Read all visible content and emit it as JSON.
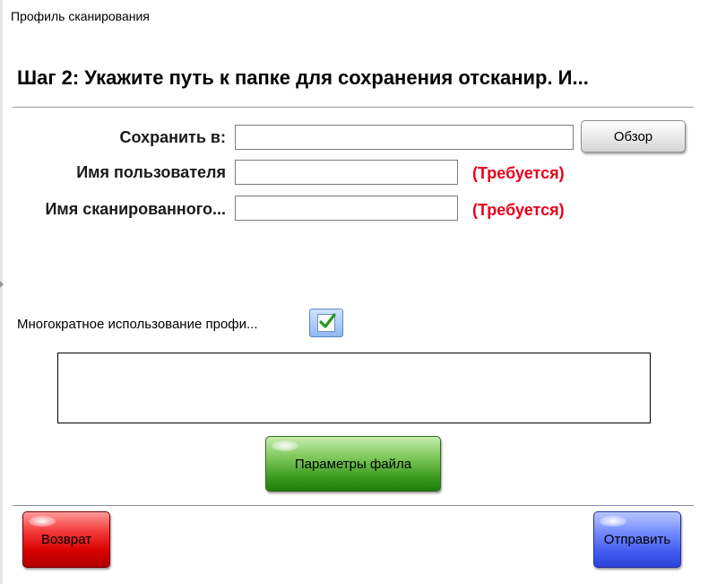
{
  "window": {
    "title": "Профиль сканирования"
  },
  "step": {
    "heading": "Шаг 2: Укажите путь к папке для сохранения отсканир. И..."
  },
  "form": {
    "save_to": {
      "label": "Сохранить в:",
      "value": "",
      "browse_label": "Обзор"
    },
    "username": {
      "label": "Имя пользователя",
      "value": "",
      "required_text": "(Требуется)"
    },
    "scanned_name": {
      "label": "Имя сканированного...",
      "value": "",
      "required_text": "(Требуется)"
    }
  },
  "reuse_profile": {
    "label": "Многократное использование профи...",
    "checked": true
  },
  "message_area": {
    "text": ""
  },
  "buttons": {
    "file_params": "Параметры файла",
    "back": "Возврат",
    "send": "Отправить"
  },
  "colors": {
    "required": "#e8001c",
    "file_params_button": "#3a9a1f",
    "back_button": "#d90000",
    "send_button": "#3f58ee",
    "check_button": "#8fb8f0"
  }
}
